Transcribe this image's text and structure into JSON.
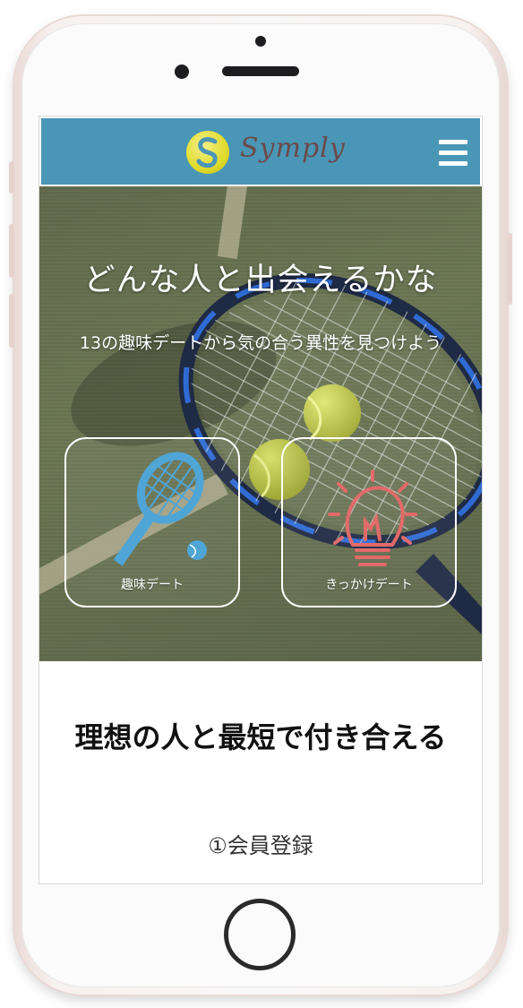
{
  "header": {
    "logo_text": "Symply",
    "menu_icon": "hamburger-menu-icon"
  },
  "hero": {
    "title": "どんな人と出会えるかな",
    "subtitle": "13の趣味デートから気の合う異性を見つけよう",
    "cards": [
      {
        "label": "趣味デート",
        "icon": "tennis-racket-icon"
      },
      {
        "label": "きっかけデート",
        "icon": "lightbulb-icon"
      }
    ]
  },
  "main": {
    "section_title": "理想の人と最短で付き合える",
    "step_1": "①会員登録"
  },
  "colors": {
    "header_bg": "#4a96b6",
    "logo_text": "#6b4a4a",
    "racket_icon": "#4fa5d6",
    "bulb_icon": "#e26a6a"
  }
}
